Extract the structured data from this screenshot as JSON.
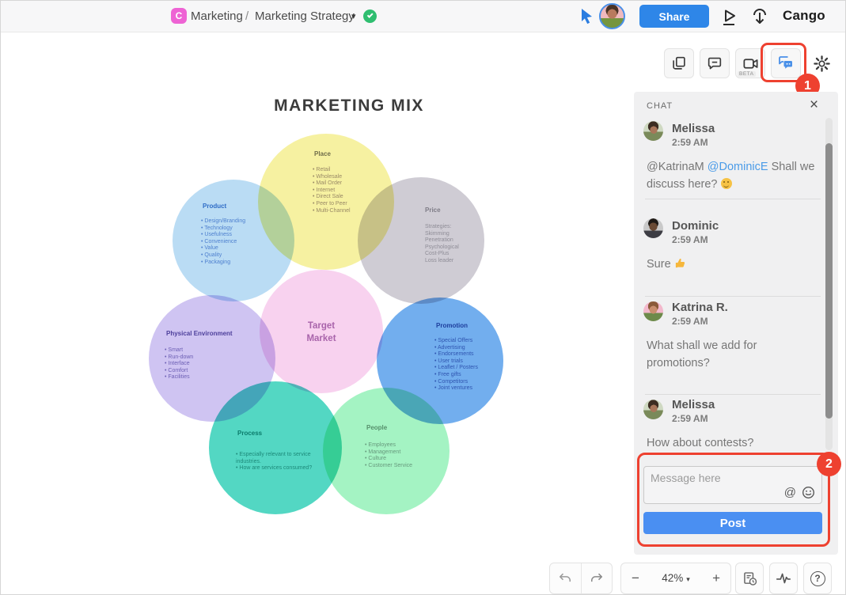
{
  "topbar": {
    "logo_letter": "C",
    "breadcrumb": {
      "parent": "Marketing",
      "separator": "/",
      "current": "Marketing Strategy",
      "caret": "▾"
    },
    "share_label": "Share",
    "brand": "Cango"
  },
  "canvas_toolbar": {
    "beta_label": "BETA",
    "callout_1": "1"
  },
  "chat_panel": {
    "title": "CHAT",
    "close_glyph": "×",
    "messages": [
      {
        "name": "Melissa",
        "time": "2:59 AM",
        "text_before": "@KatrinaM ",
        "mention": "@DominicE",
        "text_after": " Shall we discuss here? ",
        "emoji": "slightly-smiling-face"
      },
      {
        "name": "Dominic",
        "time": "2:59 AM",
        "text": "Sure ",
        "emoji": "thumbs-up"
      },
      {
        "name": "Katrina R.",
        "time": "2:59 AM",
        "text": "What shall we add for promotions?"
      },
      {
        "name": "Melissa",
        "time": "2:59 AM",
        "text": "How about contests?"
      }
    ],
    "input_placeholder": "Message here",
    "at_glyph": "@",
    "post_label": "Post",
    "callout_2": "2"
  },
  "diagram": {
    "title": "MARKETING MIX",
    "center_label": "Target Market",
    "groups": [
      {
        "id": "place",
        "label": "Place",
        "items": [
          "Retail",
          "Wholesale",
          "Mail Order",
          "Internet",
          "Direct Sale",
          "Peer to Peer",
          "Multi-Channel"
        ]
      },
      {
        "id": "product",
        "label": "Product",
        "items": [
          "Design/Branding",
          "Technology",
          "Usefulness",
          "Convenience",
          "Value",
          "Quality",
          "Packaging"
        ]
      },
      {
        "id": "price",
        "label": "Price",
        "items": [
          "Strategies:",
          "Skimming",
          "Penetration",
          "Psychological",
          "Cost-Plus",
          "Loss leader"
        ]
      },
      {
        "id": "physical-environment",
        "label": "Physical Environment",
        "items": [
          "Smart",
          "Run-down",
          "Interface",
          "Comfort",
          "Facilities"
        ]
      },
      {
        "id": "promotion",
        "label": "Promotion",
        "items": [
          "Special Offers",
          "Advertising",
          "Endorsements",
          "User trials",
          "Leaflet / Posters",
          "Free gifts",
          "Competitors",
          "Joint ventures"
        ]
      },
      {
        "id": "process",
        "label": "Process",
        "items": [
          "Especially relevant to service industries.",
          "How are services consumed?"
        ]
      },
      {
        "id": "people",
        "label": "People",
        "items": [
          "Employees",
          "Management",
          "Culture",
          "Customer Service"
        ]
      }
    ]
  },
  "bottom_bar": {
    "zoom_out": "−",
    "zoom_level": "42%",
    "zoom_caret": "▾",
    "zoom_in": "+",
    "help_glyph": "?"
  },
  "colors": {
    "accent_blue": "#2e86e8",
    "post_blue": "#4a8ff2",
    "annotation_red": "#ee4130",
    "logo_pink": "#ee63d4",
    "saved_green": "#2fbe70",
    "mention_blue": "#4a9be8",
    "chat_icon_blue": "#4a90e8",
    "circle_place": "#f6f1a1",
    "circle_product": "#badcf4",
    "circle_price": "#cfccd4",
    "circle_physical_environment": "#cfc4f2",
    "circle_promotion": "#72aeee",
    "circle_process": "#53d7c3",
    "circle_people": "#a4f3c3",
    "circle_target_market": "#f8d2ef"
  }
}
